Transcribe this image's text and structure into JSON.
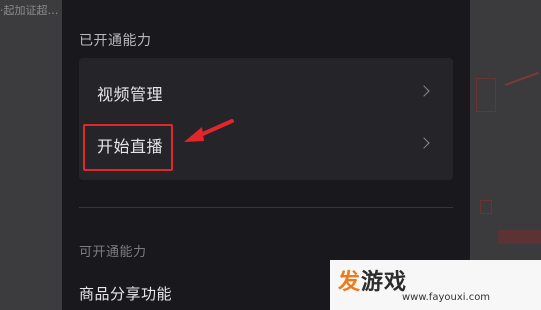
{
  "background": {
    "left_text": "·起加证超…"
  },
  "panel": {
    "enabled_title": "已开通能力",
    "items": [
      {
        "label": "视频管理"
      },
      {
        "label": "开始直播"
      }
    ],
    "available_title": "可开通能力",
    "available_items": [
      {
        "label": "商品分享功能"
      }
    ]
  },
  "annotation": {
    "highlight_color": "#e3262b"
  },
  "watermark": {
    "logo_accent": "发",
    "logo_rest": "游戏",
    "url": "www.fayouxi.com"
  },
  "colors": {
    "panel_bg": "#19191d",
    "card_bg": "#24242a",
    "text_primary": "#e6e6e8",
    "accent_orange": "#f07a16"
  }
}
